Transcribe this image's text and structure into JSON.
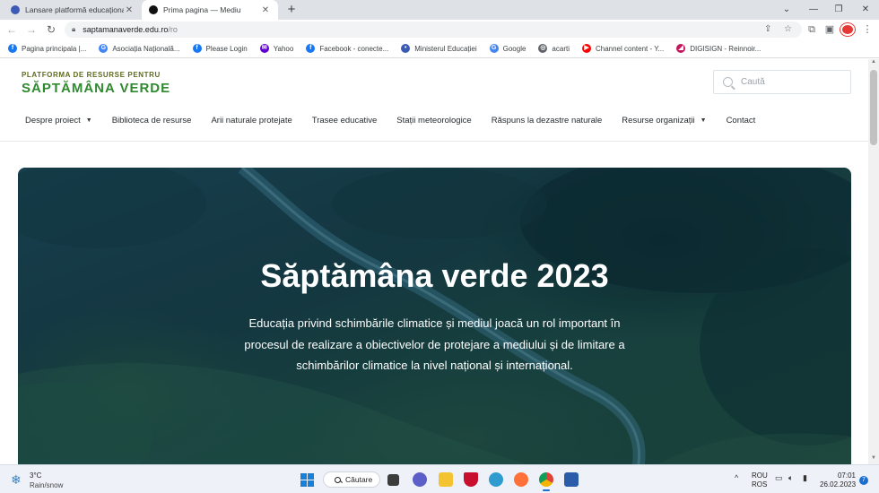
{
  "browser": {
    "tabs": [
      {
        "title": "Lansare platformă educațională S",
        "close_icon": "close-icon"
      },
      {
        "title": "Prima pagina — Mediu",
        "close_icon": "close-icon"
      }
    ],
    "new_tab_symbol": "+",
    "window_controls": {
      "collapse": "⌄",
      "minimize": "—",
      "restore": "❐",
      "close": "✕"
    },
    "nav": {
      "back": "←",
      "forward": "→",
      "reload": "↻"
    },
    "url": {
      "host": "saptamanaverde.edu.ro",
      "path": "/ro"
    },
    "toolbar_icons": {
      "share": "⇪",
      "bookmark_star": "☆",
      "extensions": "⧉",
      "side_panel": "▣",
      "menu": "⋮"
    },
    "bookmarks": [
      {
        "label": "Pagina principala |...",
        "icon": "facebook-icon",
        "color": "#1877f2",
        "glyph": "f"
      },
      {
        "label": "Asociația Națională...",
        "icon": "google-icon",
        "color": "#4285f4",
        "glyph": "G"
      },
      {
        "label": "Please Login",
        "icon": "facebook-icon",
        "color": "#1877f2",
        "glyph": "f"
      },
      {
        "label": "Yahoo",
        "icon": "yahoo-mail-icon",
        "color": "#6001d2",
        "glyph": "✉"
      },
      {
        "label": "Facebook - conecte...",
        "icon": "facebook-icon",
        "color": "#1877f2",
        "glyph": "f"
      },
      {
        "label": "Ministerul Educației",
        "icon": "ministry-icon",
        "color": "#3b5bb5",
        "glyph": "•"
      },
      {
        "label": "Google",
        "icon": "google-icon",
        "color": "#4285f4",
        "glyph": "G"
      },
      {
        "label": "acarti",
        "icon": "globe-icon",
        "color": "#5f6368",
        "glyph": "◎"
      },
      {
        "label": "Channel content - Y...",
        "icon": "youtube-icon",
        "color": "#ff0000",
        "glyph": "▶"
      },
      {
        "label": "DIGISIGN - Reinnoir...",
        "icon": "digisign-icon",
        "color": "#c2185b",
        "glyph": "◢"
      }
    ]
  },
  "site": {
    "logo": {
      "line1": "PLATFORMA DE RESURSE PENTRU",
      "line2": "SĂPTĂMÂNA VERDE"
    },
    "search": {
      "placeholder": "Caută"
    },
    "nav": [
      {
        "label": "Despre proiect",
        "has_dropdown": true
      },
      {
        "label": "Biblioteca de resurse",
        "has_dropdown": false
      },
      {
        "label": "Arii naturale protejate",
        "has_dropdown": false
      },
      {
        "label": "Trasee educative",
        "has_dropdown": false
      },
      {
        "label": "Stații meteorologice",
        "has_dropdown": false
      },
      {
        "label": "Răspuns la dezastre naturale",
        "has_dropdown": false
      },
      {
        "label": "Resurse organizații",
        "has_dropdown": true
      },
      {
        "label": "Contact",
        "has_dropdown": false
      }
    ],
    "hero": {
      "title": "Săptămâna verde 2023",
      "text": "Educația privind schimbările climatice și mediul joacă un rol important în procesul de realizare a obiectivelor de protejare a mediului și de limitare a schimbărilor climatice la nivel național și internațional."
    }
  },
  "taskbar": {
    "weather": {
      "temp": "3°C",
      "desc": "Rain/snow"
    },
    "search_label": "Căutare",
    "apps": [
      "task-view-icon",
      "teams-chat-icon",
      "file-explorer-icon",
      "mcafee-icon",
      "photos-icon",
      "firefox-icon",
      "chrome-icon",
      "save-floppy-icon"
    ],
    "lang": {
      "line1": "ROU",
      "line2": "ROS"
    },
    "time": "07:01",
    "date": "26.02.2023",
    "notifications": "7"
  }
}
